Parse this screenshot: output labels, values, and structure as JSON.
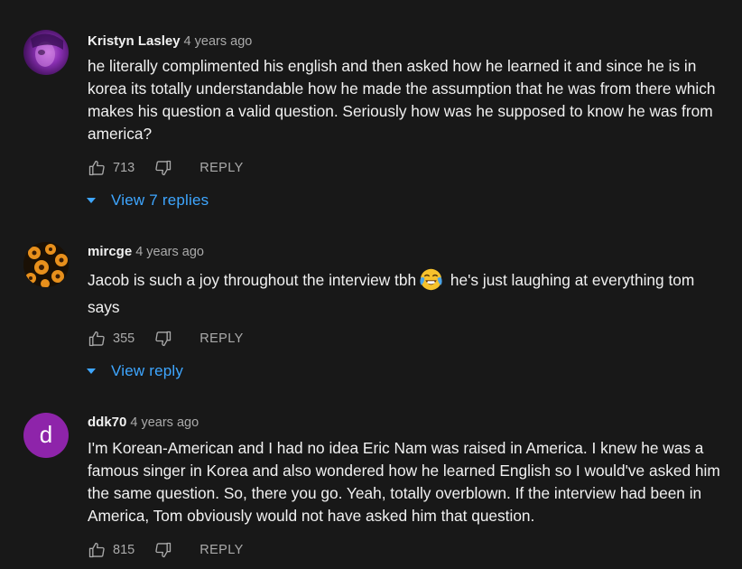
{
  "comments": [
    {
      "author": "Kristyn Lasley",
      "time": "4 years ago",
      "text": "he literally complimented his english and then asked how he learned it and since he is in korea its totally understandable how he made the assumption that he was from there which makes his question a valid question. Seriously how was he supposed to know he was from america?",
      "likes": "713",
      "reply_label": "REPLY",
      "view_replies": "View 7 replies",
      "avatar_color": "#8a2fb3"
    },
    {
      "author": "mircge",
      "time": "4 years ago",
      "text_before": "Jacob is such a joy throughout the interview tbh",
      "emoji_icon": "face-with-tears-of-joy-icon",
      "text_after": " he's just laughing at everything tom says",
      "likes": "355",
      "reply_label": "REPLY",
      "view_replies": "View reply",
      "avatar_color": "#e08a1a"
    },
    {
      "author": "ddk70",
      "time": "4 years ago",
      "avatar_letter": "d",
      "text": "I'm Korean-American and I had no idea Eric Nam was raised in America. I knew he was a famous singer in Korea and also wondered how he learned English so I would've asked him the same question. So, there you go. Yeah, totally overblown. If the interview had been in America, Tom obviously would not have asked him that question.",
      "likes": "815",
      "reply_label": "REPLY",
      "avatar_color": "#8e24aa"
    }
  ],
  "colors": {
    "background": "#181818",
    "link": "#3ea6ff",
    "secondary_text": "#aaaaaa",
    "primary_text": "#f1f1f1"
  }
}
